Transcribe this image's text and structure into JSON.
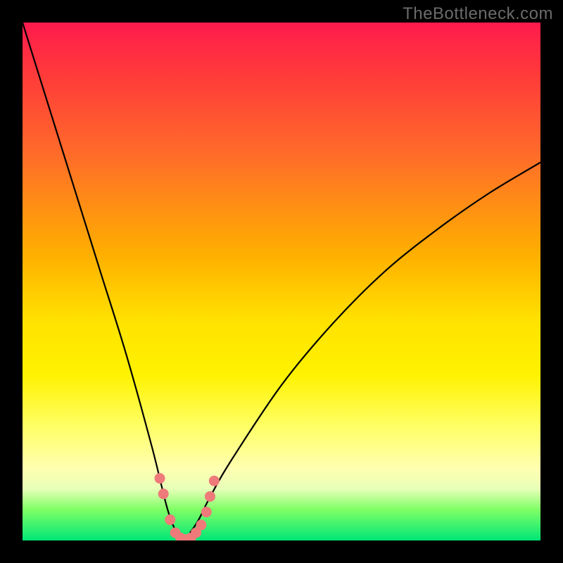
{
  "watermark": "TheBottleneck.com",
  "chart_data": {
    "type": "line",
    "title": "",
    "xlabel": "",
    "ylabel": "",
    "xlim": [
      0,
      100
    ],
    "ylim": [
      0,
      100
    ],
    "note": "Bottleneck curve with unlabeled axes. x ≈ component ratio (arbitrary 0–100), y ≈ bottleneck % (0 = green/no bottleneck, 100 = red/severe). Curve minimum near x≈31.",
    "series": [
      {
        "name": "bottleneck-curve",
        "x": [
          0,
          5,
          10,
          15,
          20,
          25,
          28,
          30,
          31,
          32,
          34,
          36,
          40,
          50,
          60,
          70,
          80,
          90,
          100
        ],
        "y": [
          100,
          84,
          68,
          52,
          36,
          18,
          6,
          1,
          0,
          1,
          4,
          8,
          15,
          30,
          42,
          52,
          60,
          67,
          73
        ]
      }
    ],
    "markers": {
      "name": "highlight-dots",
      "color": "#ef7a7a",
      "points_x": [
        26.5,
        27.2,
        28.5,
        29.5,
        30.5,
        31.5,
        32.5,
        33.5,
        34.5,
        35.5,
        36.2,
        37.0
      ],
      "points_y": [
        12,
        9,
        4,
        1.5,
        0.5,
        0.2,
        0.5,
        1.5,
        3.0,
        5.5,
        8.5,
        11.5
      ]
    },
    "gradient_stops": [
      {
        "pos": 0.0,
        "color": "#ff1a4d"
      },
      {
        "pos": 0.25,
        "color": "#ff6a2a"
      },
      {
        "pos": 0.58,
        "color": "#ffe300"
      },
      {
        "pos": 0.86,
        "color": "#ffffb0"
      },
      {
        "pos": 1.0,
        "color": "#00e676"
      }
    ]
  }
}
